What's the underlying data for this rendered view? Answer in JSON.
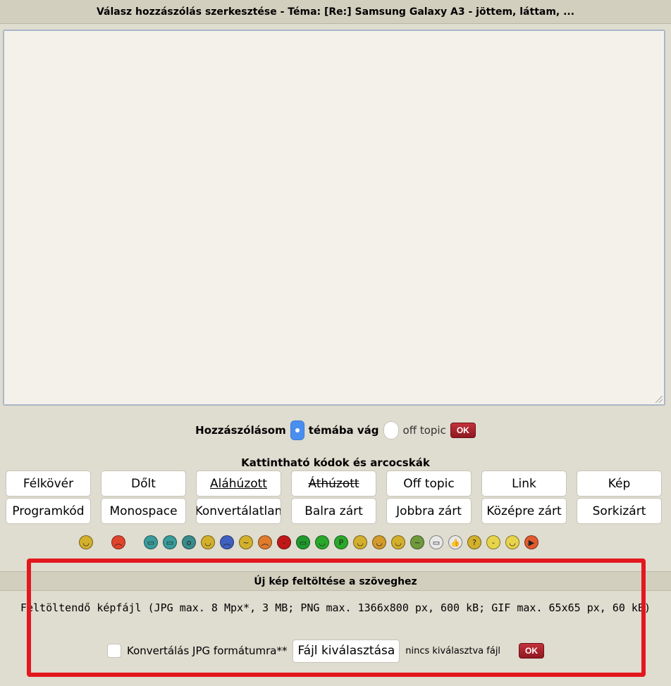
{
  "title": "Válasz hozzászólás szerkesztése - Téma: [Re:] Samsung Galaxy A3 - jöttem, láttam, ...",
  "editor": {
    "value": ""
  },
  "post_type": {
    "prefix": "Hozzászólásom",
    "option_on_topic": "témába vág",
    "option_off_topic": "off topic",
    "ok_label": "OK",
    "selected": "témába vág"
  },
  "codes": {
    "title": "Kattintható kódok és arcocskák",
    "buttons": [
      "Félkövér",
      "Dőlt",
      "Aláhúzott",
      "Áthúzott",
      "Off topic",
      "Link",
      "Kép",
      "Programkód",
      "Monospace",
      "Konvertálatlan",
      "Balra zárt",
      "Jobbra zárt",
      "Középre zárt",
      "Sorkizárt"
    ]
  },
  "smileys": [
    {
      "icon": "smile-icon",
      "color": "#d3b02c",
      "glyph": "◡"
    },
    {
      "icon": "angry-icon",
      "color": "#e0442c",
      "glyph": "︵"
    },
    {
      "icon": "grin-teeth-icon",
      "color": "#3a9b9b",
      "glyph": "▭"
    },
    {
      "icon": "laugh-icon",
      "color": "#3a9b9b",
      "glyph": "▭"
    },
    {
      "icon": "shock-icon",
      "color": "#3a8b8b",
      "glyph": "o"
    },
    {
      "icon": "happy-icon",
      "color": "#d3b02c",
      "glyph": "◡"
    },
    {
      "icon": "sad-blue-icon",
      "color": "#4060c0",
      "glyph": "︵"
    },
    {
      "icon": "worried-icon",
      "color": "#d3b02c",
      "glyph": "~"
    },
    {
      "icon": "mad-icon",
      "color": "#e07a2c",
      "glyph": "︵"
    },
    {
      "icon": "red-face-icon",
      "color": "#c01818",
      "glyph": "-"
    },
    {
      "icon": "green-monster-icon",
      "color": "#1f9a2c",
      "glyph": "▭"
    },
    {
      "icon": "green-grin-icon",
      "color": "#2aa82a",
      "glyph": "◡"
    },
    {
      "icon": "green-tongue-icon",
      "color": "#2aa82a",
      "glyph": "P"
    },
    {
      "icon": "wink-icon",
      "color": "#d3b02c",
      "glyph": "◡"
    },
    {
      "icon": "blush-icon",
      "color": "#d39a2c",
      "glyph": "◡"
    },
    {
      "icon": "grin-icon",
      "color": "#d3b02c",
      "glyph": "◡"
    },
    {
      "icon": "sick-green-icon",
      "color": "#6f9a3c",
      "glyph": "~"
    },
    {
      "icon": "big-grin-icon",
      "color": "#e8e8e8",
      "glyph": "▭"
    },
    {
      "icon": "thumbs-up-icon",
      "color": "#e8e8e8",
      "glyph": "👍"
    },
    {
      "icon": "confused-icon",
      "color": "#d3b02c",
      "glyph": "?"
    },
    {
      "icon": "neutral-icon",
      "color": "#e8d44a",
      "glyph": "-"
    },
    {
      "icon": "waving-icon",
      "color": "#e8d44a",
      "glyph": "◡"
    },
    {
      "icon": "flag-icon",
      "color": "#e05a2c",
      "glyph": "▶"
    }
  ],
  "upload": {
    "title": "Új kép feltöltése a szöveghez",
    "info": "Feltöltendő képfájl (JPG max. 8 Mpx*, 3 MB; PNG max. 1366x800 px, 600 kB; GIF max. 65x65 px, 60 kB)",
    "convert_label": "Konvertálás JPG formátumra**",
    "file_button": "Fájl kiválasztása",
    "no_file": "nincs kiválasztva fájl",
    "ok_label": "OK"
  }
}
